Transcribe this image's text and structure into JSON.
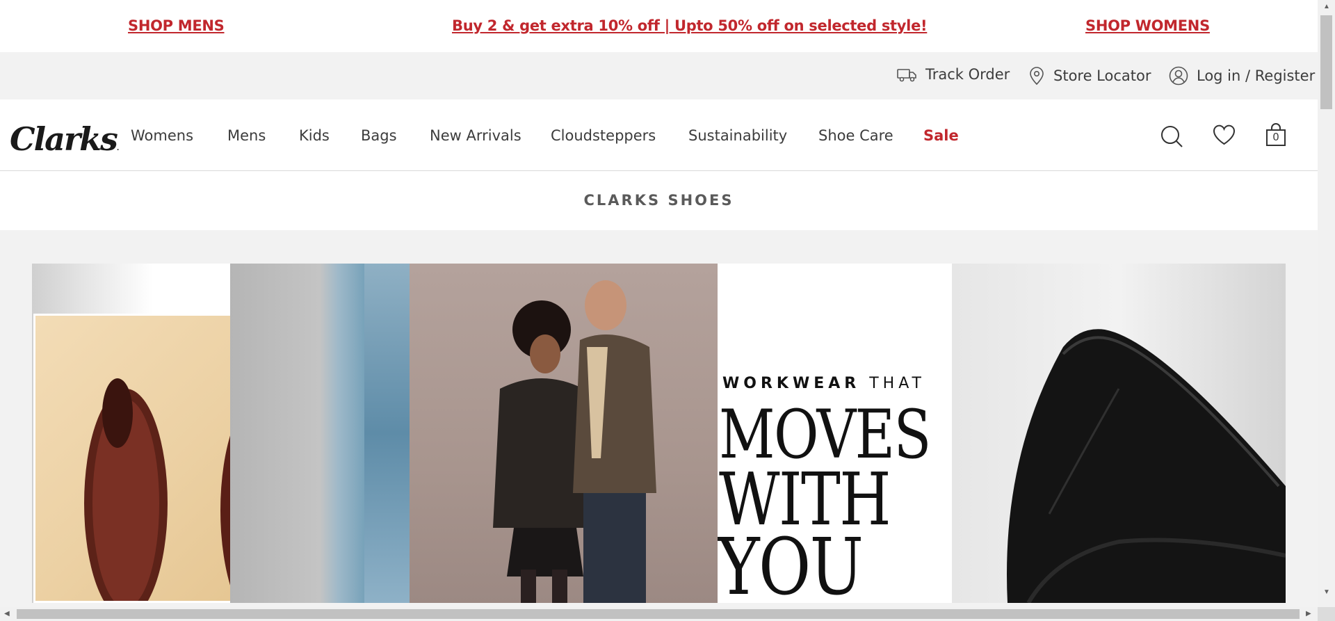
{
  "promo": {
    "shop_mens": "SHOP MENS",
    "offer": "Buy 2 & get extra 10% off  |  Upto 50% off on selected style!",
    "shop_womens": "SHOP WOMENS "
  },
  "utility": {
    "track_order": "Track Order",
    "store_locator": "Store Locator",
    "login": "Log in / Register"
  },
  "header": {
    "logo": "Clarks",
    "nav": {
      "womens": "Womens",
      "mens": "Mens",
      "kids": "Kids",
      "bags": "Bags",
      "new_arrivals": "New Arrivals",
      "cloudsteppers": "Cloudsteppers",
      "sustainability": "Sustainability",
      "shoe_care": "Shoe Care",
      "sale": "Sale"
    },
    "bag_count": "0"
  },
  "page": {
    "title": "CLARKS SHOES"
  },
  "hero": {
    "tag_bold": "WORKWEAR",
    "tag_light": "THAT",
    "line1": "MOVES",
    "line2": "WITH",
    "line3": "YOU"
  },
  "colors": {
    "brand_red": "#c1272d",
    "text": "#3c3c3c",
    "background": "#f2f2f2"
  },
  "icons": [
    "truck-icon",
    "location-pin-icon",
    "user-icon",
    "search-icon",
    "heart-icon",
    "shopping-bag-icon"
  ]
}
